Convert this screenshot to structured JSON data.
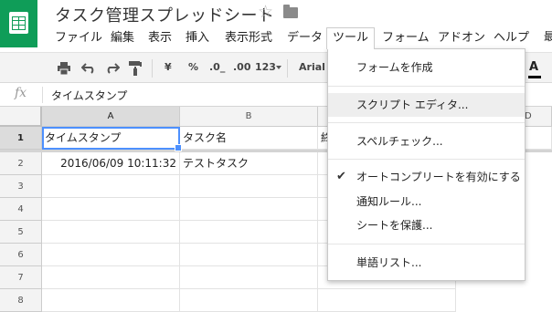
{
  "doc": {
    "title": "タスク管理スプレッドシート",
    "star": "☆"
  },
  "menubar": {
    "items": [
      "ファイル",
      "編集",
      "表示",
      "挿入",
      "表示形式",
      "データ",
      "ツール",
      "フォーム",
      "アドオン",
      "ヘルプ"
    ],
    "right_edge": "最"
  },
  "toolbar": {
    "currency": "¥",
    "percent": "%",
    "decrease_decimal": ".0_",
    "increase_decimal": ".00",
    "number_format": "123",
    "font": "Arial",
    "text_color_label": "A"
  },
  "formula_bar": {
    "fx_label": "fx",
    "value": "タイムスタンプ"
  },
  "grid": {
    "columns": [
      "A",
      "B",
      "",
      "",
      "D"
    ],
    "rows": [
      "1",
      "2",
      "3",
      "4",
      "5",
      "6",
      "7",
      "8",
      "9"
    ],
    "cells": {
      "a1": "タイムスタンプ",
      "b1": "タスク名",
      "c1_partial": "終",
      "a2": "2016/06/09 10:11:32",
      "b2": "テストタスク"
    }
  },
  "tools_menu": {
    "create_form": "フォームを作成",
    "script_editor": "スクリプト エディタ...",
    "spellcheck": "スペルチェック...",
    "autocomplete": "オートコンプリートを有効にする",
    "autocomplete_checked": "✔",
    "notification_rules": "通知ルール...",
    "protect_sheet": "シートを保護...",
    "word_list": "単語リスト..."
  },
  "colors": {
    "brand": "#0f9d58",
    "selection": "#4d90fe"
  }
}
